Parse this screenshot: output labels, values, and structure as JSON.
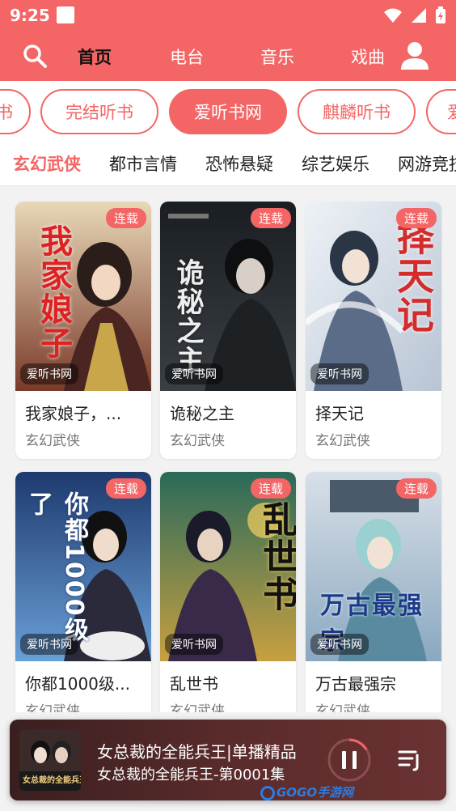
{
  "status": {
    "time": "9:25"
  },
  "nav": {
    "tabs": [
      {
        "label": "首页",
        "active": true
      },
      {
        "label": "电台",
        "active": false
      },
      {
        "label": "音乐",
        "active": false
      },
      {
        "label": "戏曲",
        "active": false
      }
    ]
  },
  "pills": [
    {
      "label": "书"
    },
    {
      "label": "完结听书"
    },
    {
      "label": "爱听书网",
      "active": true
    },
    {
      "label": "麒麟听书"
    },
    {
      "label": "爱"
    }
  ],
  "categories": [
    {
      "label": "玄幻武侠",
      "active": true
    },
    {
      "label": "都市言情"
    },
    {
      "label": "恐怖悬疑"
    },
    {
      "label": "综艺娱乐"
    },
    {
      "label": "网游竞技"
    }
  ],
  "books": [
    {
      "title": "我家娘子，...",
      "genre": "玄幻武侠",
      "badge": "连载",
      "source": "爱听书网",
      "cover_text": "我家娘子"
    },
    {
      "title": "诡秘之主",
      "genre": "玄幻武侠",
      "badge": "连载",
      "source": "爱听书网",
      "cover_text": "诡秘之主"
    },
    {
      "title": "择天记",
      "genre": "玄幻武侠",
      "badge": "连载",
      "source": "爱听书网",
      "cover_text": "择天记"
    },
    {
      "title": "你都1000级...",
      "genre": "玄幻武侠",
      "badge": "连载",
      "source": "爱听书网",
      "cover_text": "你都1000级了"
    },
    {
      "title": "乱世书",
      "genre": "玄幻武侠",
      "badge": "连载",
      "source": "爱听书网",
      "cover_text": "乱世书"
    },
    {
      "title": "万古最强宗",
      "genre": "玄幻武侠",
      "badge": "连载",
      "source": "爱听书网",
      "cover_text": "万古最强宗"
    }
  ],
  "player": {
    "title": "女总裁的全能兵王|单播精品",
    "subtitle": "女总裁的全能兵王-第0001集",
    "thumb_text": "女总裁的全能兵王"
  },
  "watermark": "GOGO手游网",
  "colors": {
    "accent": "#f46565"
  }
}
